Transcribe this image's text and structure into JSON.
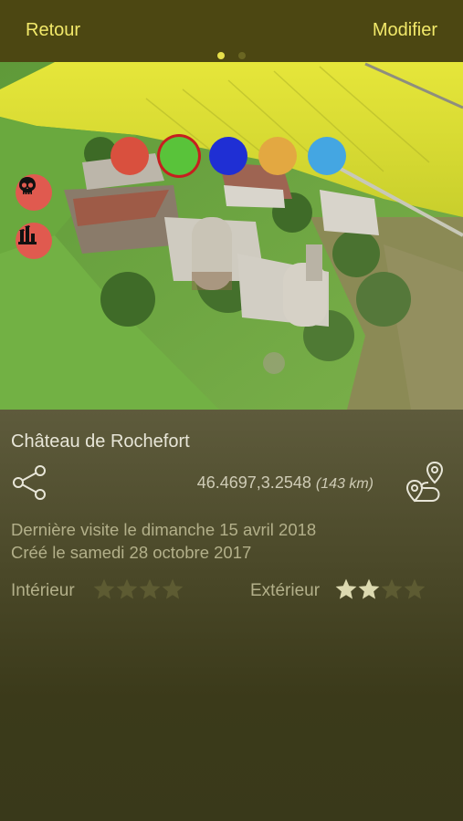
{
  "nav": {
    "back_label": "Retour",
    "edit_label": "Modifier",
    "page_dots": [
      true,
      false
    ]
  },
  "colors": {
    "options": [
      "#d9503e",
      "#59c33a",
      "#1f2fd4",
      "#e3a841",
      "#44a6e2"
    ],
    "selected_index": 1,
    "accent": "#f2e96a",
    "marker": "#e05a4f"
  },
  "side_icons": [
    "skull-icon",
    "ruins-icon"
  ],
  "categories": {
    "icons": [
      "dot-icon",
      "castle-icon",
      "church-icon",
      "factory-icon",
      "bridge-icon",
      "house-icon",
      "hospital-icon",
      "tank-icon"
    ],
    "selected_index": 1
  },
  "place": {
    "name": "Château de Rochefort",
    "coordinates": "46.4697,3.2548",
    "distance": "(143 km)",
    "last_visit": "Dernière visite le dimanche 15 avril 2018",
    "created": "Créé le samedi 28 octobre 2017"
  },
  "ratings": {
    "interior_label": "Intérieur",
    "interior_stars": 0,
    "exterior_label": "Extérieur",
    "exterior_stars": 2,
    "max_stars": 4
  }
}
